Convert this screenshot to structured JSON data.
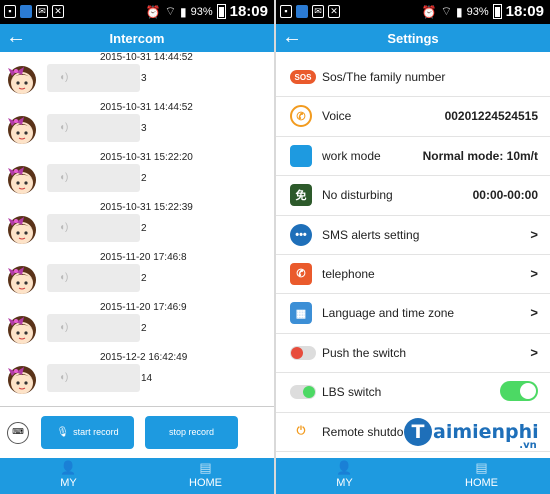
{
  "status_bar": {
    "battery": "93%",
    "time": "18:09"
  },
  "left": {
    "title": "Intercom",
    "messages": [
      {
        "timestamp": "2015-10-31 14:44:52",
        "duration": "3"
      },
      {
        "timestamp": "2015-10-31 14:44:52",
        "duration": "3"
      },
      {
        "timestamp": "2015-10-31 15:22:20",
        "duration": "2"
      },
      {
        "timestamp": "2015-10-31 15:22:39",
        "duration": "2"
      },
      {
        "timestamp": "2015-11-20 17:46:8",
        "duration": "2"
      },
      {
        "timestamp": "2015-11-20 17:46:9",
        "duration": "2"
      },
      {
        "timestamp": "2015-12-2 16:42:49",
        "duration": "14"
      }
    ],
    "start_record": "start record",
    "stop_record": "stop record",
    "nav": [
      {
        "label": "MY",
        "icon": "person-icon"
      },
      {
        "label": "HOME",
        "icon": "book-icon"
      }
    ]
  },
  "right": {
    "title": "Settings",
    "rows": [
      {
        "icon_text": "SOS",
        "label": "Sos/The family number",
        "value": ""
      },
      {
        "icon_text": "✆",
        "label": "Voice",
        "value": "00201224524515"
      },
      {
        "icon_text": "",
        "label": "work mode",
        "value": "Normal mode: 10m/t"
      },
      {
        "icon_text": "免",
        "label": "No disturbing",
        "value": "00:00-00:00"
      },
      {
        "icon_text": "•••",
        "label": "SMS alerts setting",
        "value": ">"
      },
      {
        "icon_text": "✆",
        "label": "telephone",
        "value": ">"
      },
      {
        "icon_text": "▦",
        "label": "Language and time zone",
        "value": ">"
      },
      {
        "icon_text": "",
        "label": "Push the switch",
        "value": ">"
      },
      {
        "icon_text": "",
        "label": "LBS switch",
        "value": ""
      },
      {
        "icon_text": "⏻",
        "label": "Remote shutdo",
        "value": ""
      }
    ],
    "nav": [
      {
        "label": "MY",
        "icon": "person-icon"
      },
      {
        "label": "HOME",
        "icon": "book-icon"
      }
    ],
    "watermark": {
      "text": "aimienphi",
      "sub": ".vn",
      "letter": "T"
    }
  },
  "colors": {
    "accent": "#1e9ae0",
    "toggle_on": "#4cd964",
    "toggle_off": "#e74c3c"
  }
}
